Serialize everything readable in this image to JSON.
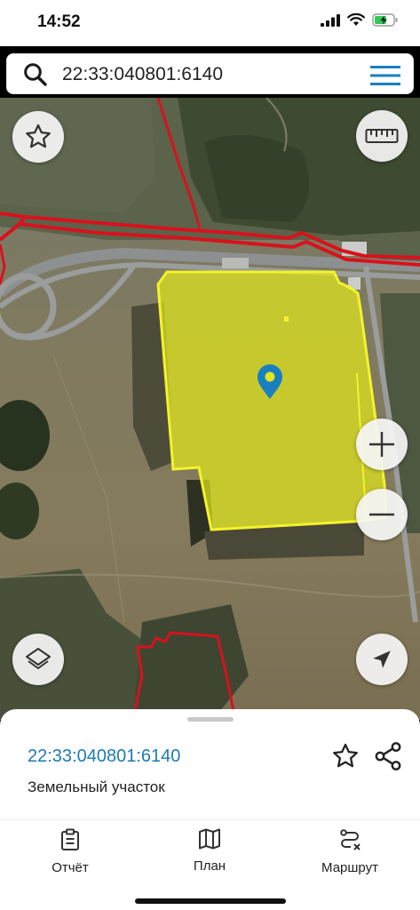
{
  "status_bar": {
    "time": "14:52"
  },
  "search": {
    "value": "22:33:040801:6140"
  },
  "map": {
    "parcel_fill": "#e1e61c",
    "parcel_outline": "#f3f32a",
    "boundary_color": "#d8121d",
    "marker_color": "#1a7fc1",
    "buttons": {
      "favorite": "star-icon",
      "ruler": "ruler-icon",
      "zoom_in": "plus-icon",
      "zoom_out": "minus-icon",
      "layers": "layers-icon",
      "locate": "navigation-arrow-icon"
    }
  },
  "sheet": {
    "parcel_id": "22:33:040801:6140",
    "parcel_type": "Земельный участок"
  },
  "tabs": [
    {
      "label": "Отчёт",
      "icon": "report-clipboard-icon"
    },
    {
      "label": "План",
      "icon": "map-plan-icon"
    },
    {
      "label": "Маршрут",
      "icon": "route-icon"
    }
  ]
}
